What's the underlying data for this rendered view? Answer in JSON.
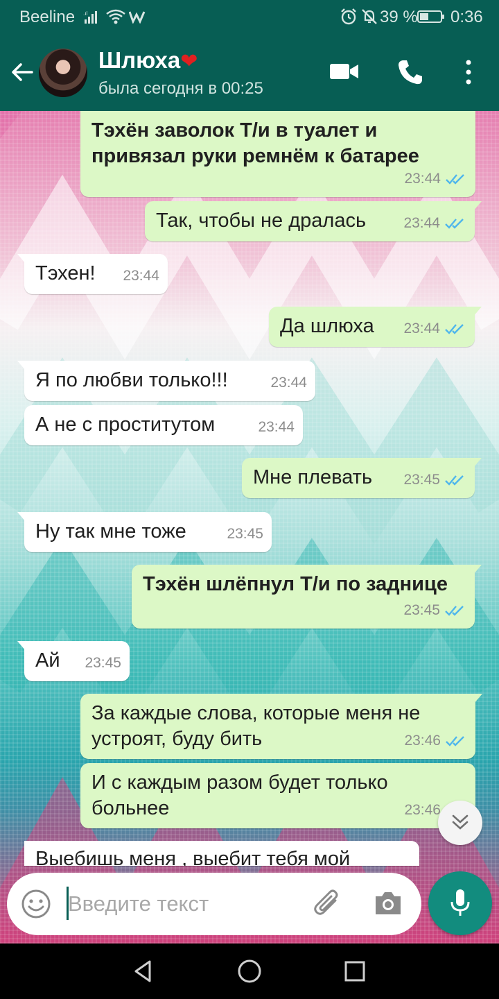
{
  "status_bar": {
    "carrier": "Beeline",
    "battery": "39 %",
    "time": "0:36",
    "icons": [
      "signal-icon",
      "wifi-icon",
      "whatsapp-notification-icon",
      "alarm-icon",
      "mute-icon",
      "battery-icon"
    ]
  },
  "header": {
    "contact_name": "Шлюха",
    "heart": "❤",
    "last_seen": "была сегодня в 00:25",
    "icons": [
      "back-arrow-icon",
      "video-call-icon",
      "phone-icon",
      "more-vertical-icon"
    ]
  },
  "messages": [
    {
      "direction": "out",
      "bold": true,
      "text": "Тэхён заволок Т/и в туалет и привязал руки ремнём к батарее",
      "time": "23:44",
      "status": "read"
    },
    {
      "direction": "out",
      "bold": false,
      "text": "Так, чтобы не дралась",
      "time": "23:44",
      "status": "read"
    },
    {
      "direction": "in",
      "bold": false,
      "text": "Тэхен!",
      "time": "23:44"
    },
    {
      "direction": "out",
      "bold": false,
      "text": "Да шлюха",
      "time": "23:44",
      "status": "read"
    },
    {
      "direction": "in",
      "bold": false,
      "text": "Я по любви только!!!",
      "time": "23:44"
    },
    {
      "direction": "in",
      "bold": false,
      "text": "А не с проститутом",
      "time": "23:44"
    },
    {
      "direction": "out",
      "bold": false,
      "text": "Мне плевать",
      "time": "23:45",
      "status": "read"
    },
    {
      "direction": "in",
      "bold": false,
      "text": "Ну так мне тоже",
      "time": "23:45"
    },
    {
      "direction": "out",
      "bold": true,
      "text": "Тэхён шлёпнул Т/и по заднице",
      "time": "23:45",
      "status": "read"
    },
    {
      "direction": "in",
      "bold": false,
      "text": "Ай",
      "time": "23:45"
    },
    {
      "direction": "out",
      "bold": false,
      "text": "За каждые слова, которые меня не устроят, буду бить",
      "time": "23:46",
      "status": "read"
    },
    {
      "direction": "out",
      "bold": false,
      "text": "И с каждым разом будет только больнее",
      "time": "23:46",
      "status": "read"
    },
    {
      "direction": "in",
      "bold": false,
      "text": "Выебишь меня , выебит тебя мой",
      "time": ""
    }
  ],
  "input": {
    "placeholder": "Введите текст"
  },
  "colors": {
    "header": "#075e54",
    "outgoing_bubble": "#dcf8c6",
    "incoming_bubble": "#ffffff",
    "read_tick": "#4fb6ec",
    "mic_button": "#128c7e"
  }
}
